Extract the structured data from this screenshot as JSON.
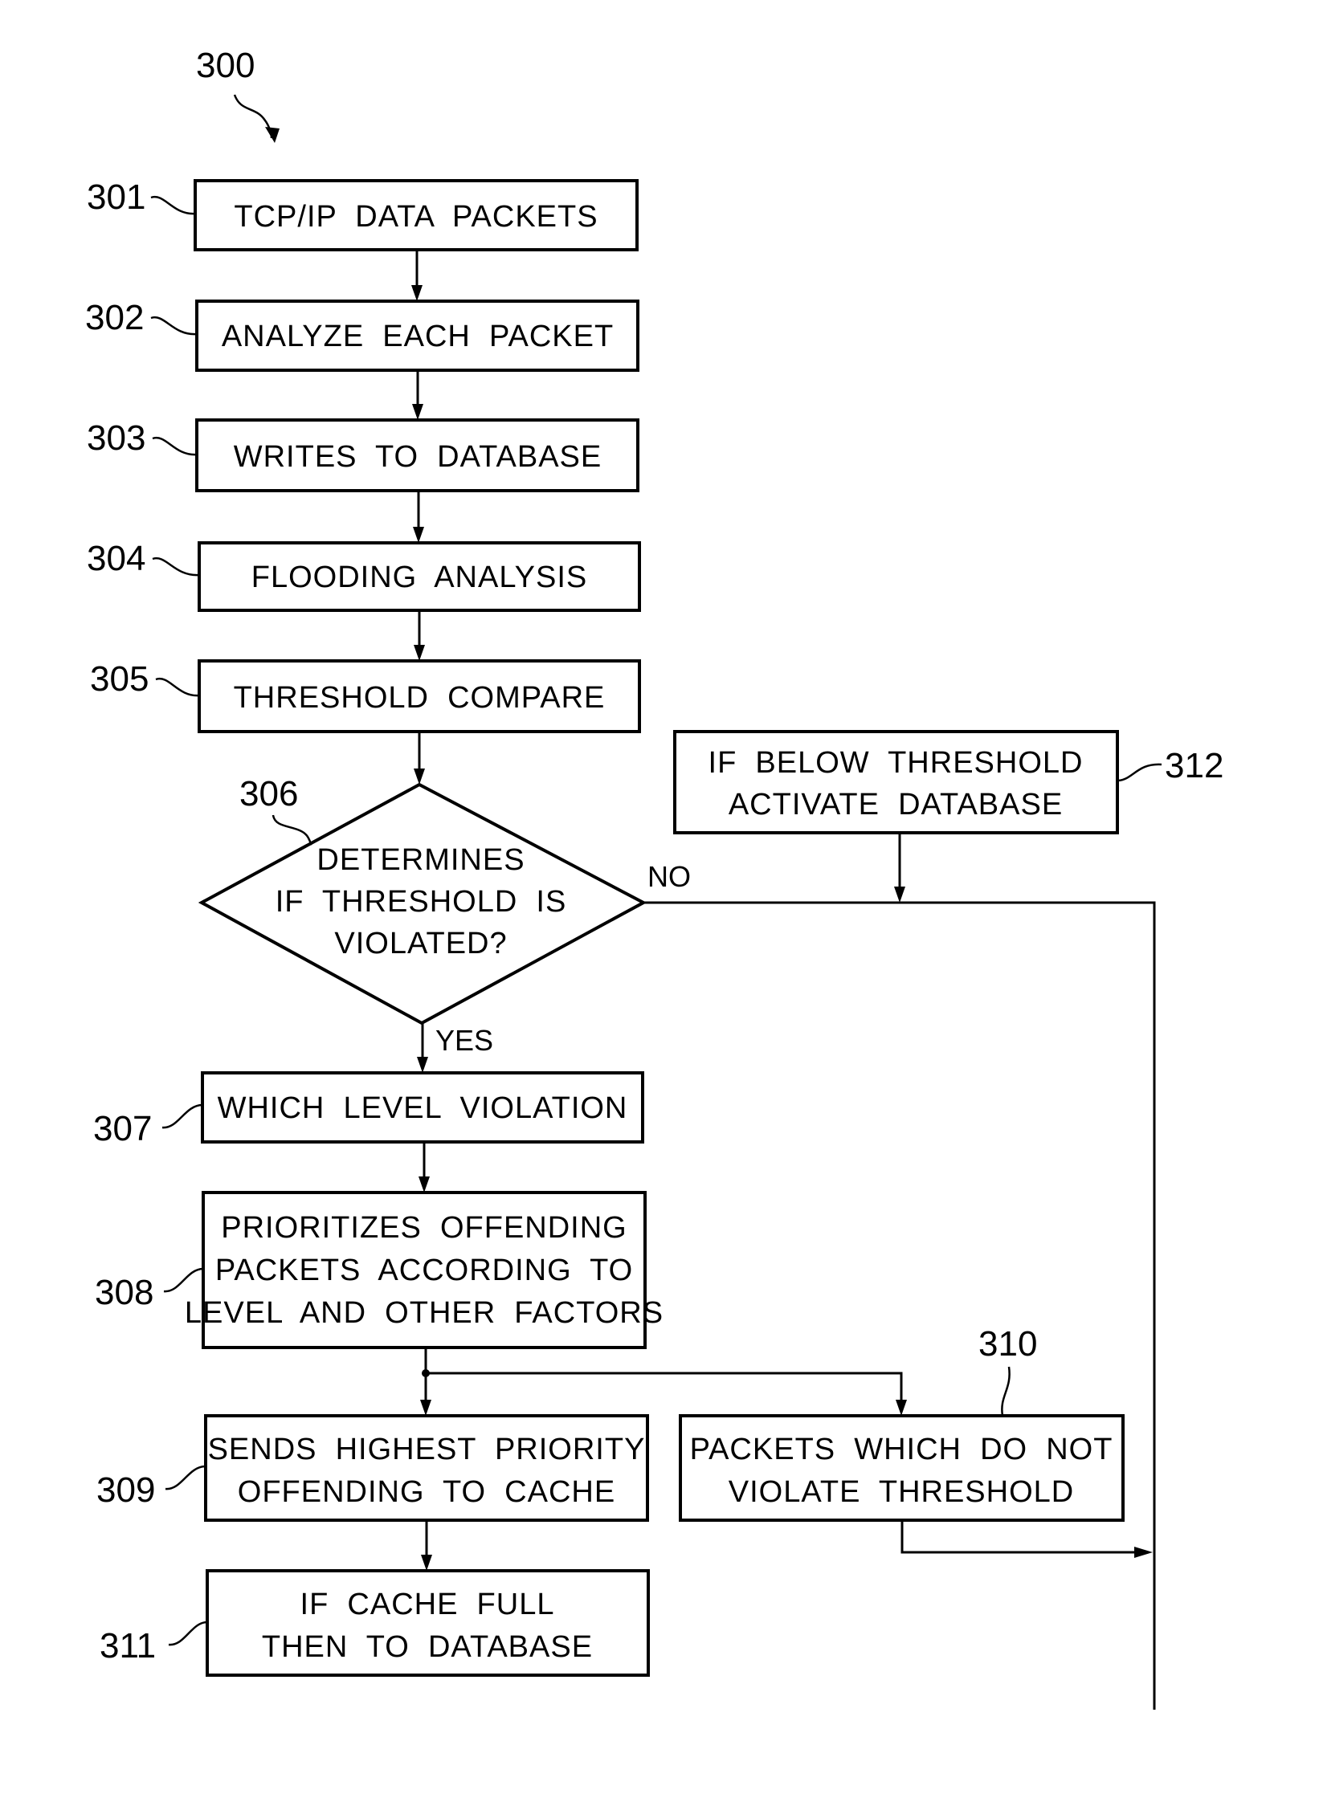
{
  "figure": {
    "ref": "300"
  },
  "steps": [
    {
      "ref": "301",
      "lines": [
        "TCP/IP  DATA  PACKETS"
      ]
    },
    {
      "ref": "302",
      "lines": [
        "ANALYZE  EACH  PACKET"
      ]
    },
    {
      "ref": "303",
      "lines": [
        "WRITES  TO  DATABASE"
      ]
    },
    {
      "ref": "304",
      "lines": [
        "FLOODING  ANALYSIS"
      ]
    },
    {
      "ref": "305",
      "lines": [
        "THRESHOLD  COMPARE"
      ]
    },
    {
      "ref": "306",
      "lines": [
        "DETERMINES",
        "IF  THRESHOLD  IS",
        "VIOLATED?"
      ]
    },
    {
      "ref": "307",
      "lines": [
        "WHICH  LEVEL  VIOLATION"
      ]
    },
    {
      "ref": "308",
      "lines": [
        "PRIORITIZES  OFFENDING",
        "PACKETS  ACCORDING  TO",
        "LEVEL  AND  OTHER  FACTORS"
      ]
    },
    {
      "ref": "309",
      "lines": [
        "SENDS  HIGHEST  PRIORITY",
        "OFFENDING  TO  CACHE"
      ]
    },
    {
      "ref": "310",
      "lines": [
        "PACKETS  WHICH  DO  NOT",
        "VIOLATE  THRESHOLD"
      ]
    },
    {
      "ref": "311",
      "lines": [
        "IF  CACHE  FULL",
        "THEN  TO  DATABASE"
      ]
    },
    {
      "ref": "312",
      "lines": [
        "IF  BELOW  THRESHOLD",
        "ACTIVATE  DATABASE"
      ]
    }
  ],
  "branches": {
    "no": "NO",
    "yes": "YES"
  }
}
